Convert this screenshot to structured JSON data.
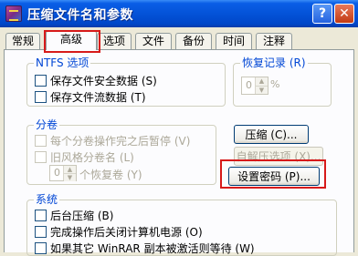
{
  "window": {
    "title": "压缩文件名和参数",
    "help_label": "?",
    "close_label": "✕"
  },
  "tabs": [
    {
      "label": "常规",
      "active": false
    },
    {
      "label": "高级",
      "active": true
    },
    {
      "label": "选项",
      "active": false
    },
    {
      "label": "文件",
      "active": false
    },
    {
      "label": "备份",
      "active": false
    },
    {
      "label": "时间",
      "active": false
    },
    {
      "label": "注释",
      "active": false
    }
  ],
  "ntfs": {
    "title": "NTFS 选项",
    "options": [
      {
        "label": "保存文件安全数据 (S)",
        "checked": false,
        "enabled": true
      },
      {
        "label": "保存文件流数据 (T)",
        "checked": false,
        "enabled": true
      }
    ]
  },
  "recovery": {
    "title": "恢复记录 (R)",
    "value": "0",
    "unit": "%"
  },
  "split": {
    "title": "分卷",
    "options": [
      {
        "label": "每个分卷操作完之后暂停 (V)",
        "checked": false,
        "enabled": false
      },
      {
        "label": "旧风格分卷名 (L)",
        "checked": false,
        "enabled": false
      }
    ],
    "recovery_volumes_value": "0",
    "recovery_volumes_label": "个恢复卷 (Y)"
  },
  "buttons": {
    "compress": "压缩 (C)...",
    "sfx": "自解压选项 (X)...",
    "set_password": "设置密码 (P)..."
  },
  "system": {
    "title": "系统",
    "options": [
      {
        "label": "后台压缩 (B)",
        "checked": false,
        "enabled": true
      },
      {
        "label": "完成操作后关闭计算机电源 (O)",
        "checked": false,
        "enabled": true
      },
      {
        "label": "如果其它 WinRAR 副本被激活则等待 (W)",
        "checked": false,
        "enabled": true
      }
    ]
  },
  "colors": {
    "titlebar": "#0453D8",
    "group_title": "#0046D5",
    "highlight": "#D71A1A",
    "active_tab_accent": "#F7B94A"
  }
}
